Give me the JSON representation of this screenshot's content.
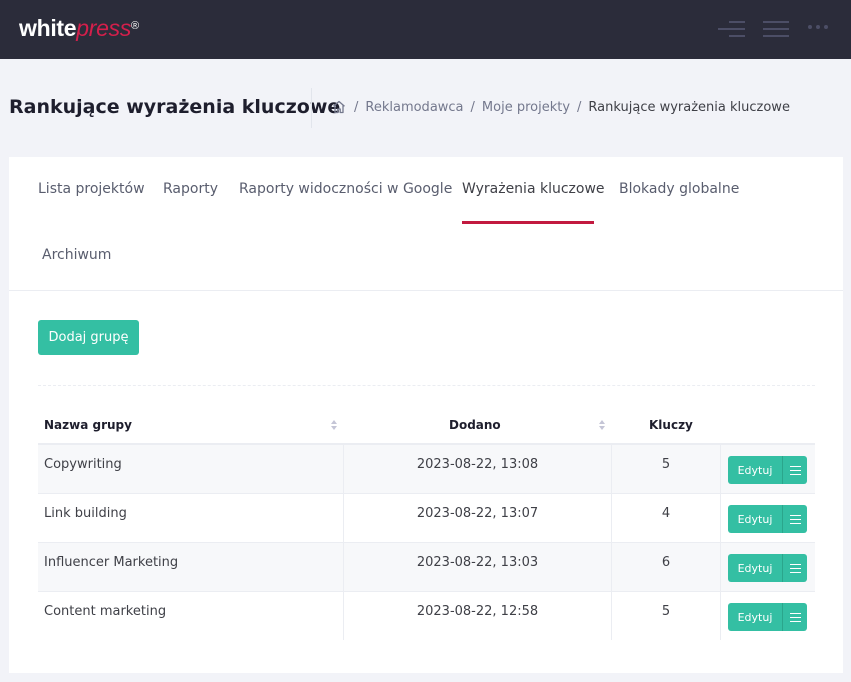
{
  "app": {
    "logo_main": "white",
    "logo_accent": "press",
    "logo_mark": "®"
  },
  "header_icons": [
    "aside-toggle-icon",
    "menu-icon",
    "more-dots-icon"
  ],
  "page": {
    "title": "Rankujące wyrażenia kluczowe"
  },
  "breadcrumb": {
    "home_icon": "home-icon",
    "items": [
      "Reklamodawca",
      "Moje projekty",
      "Rankujące wyrażenia kluczowe"
    ],
    "separator": "/"
  },
  "tabs": [
    {
      "label": "Lista projektów"
    },
    {
      "label": "Raporty"
    },
    {
      "label": "Raporty widoczności w Google"
    },
    {
      "label": "Wyrażenia kluczowe",
      "active": true
    },
    {
      "label": "Blokady globalne"
    },
    {
      "label": "Archiwum"
    }
  ],
  "actions": {
    "add_group": "Dodaj grupę"
  },
  "table": {
    "columns": [
      "Nazwa grupy",
      "Dodano",
      "Kluczy"
    ],
    "rows": [
      {
        "name": "Copywriting",
        "added": "2023-08-22, 13:08",
        "keys": "5",
        "edit": "Edytuj"
      },
      {
        "name": "Link building",
        "added": "2023-08-22, 13:07",
        "keys": "4",
        "edit": "Edytuj"
      },
      {
        "name": "Influencer Marketing",
        "added": "2023-08-22, 13:03",
        "keys": "6",
        "edit": "Edytuj"
      },
      {
        "name": "Content marketing",
        "added": "2023-08-22, 12:58",
        "keys": "5",
        "edit": "Edytuj"
      }
    ]
  },
  "colors": {
    "topbar": "#2b2c3a",
    "accent": "#d41f4b",
    "tab_active": "#c2193f",
    "button": "#34bfa3"
  }
}
